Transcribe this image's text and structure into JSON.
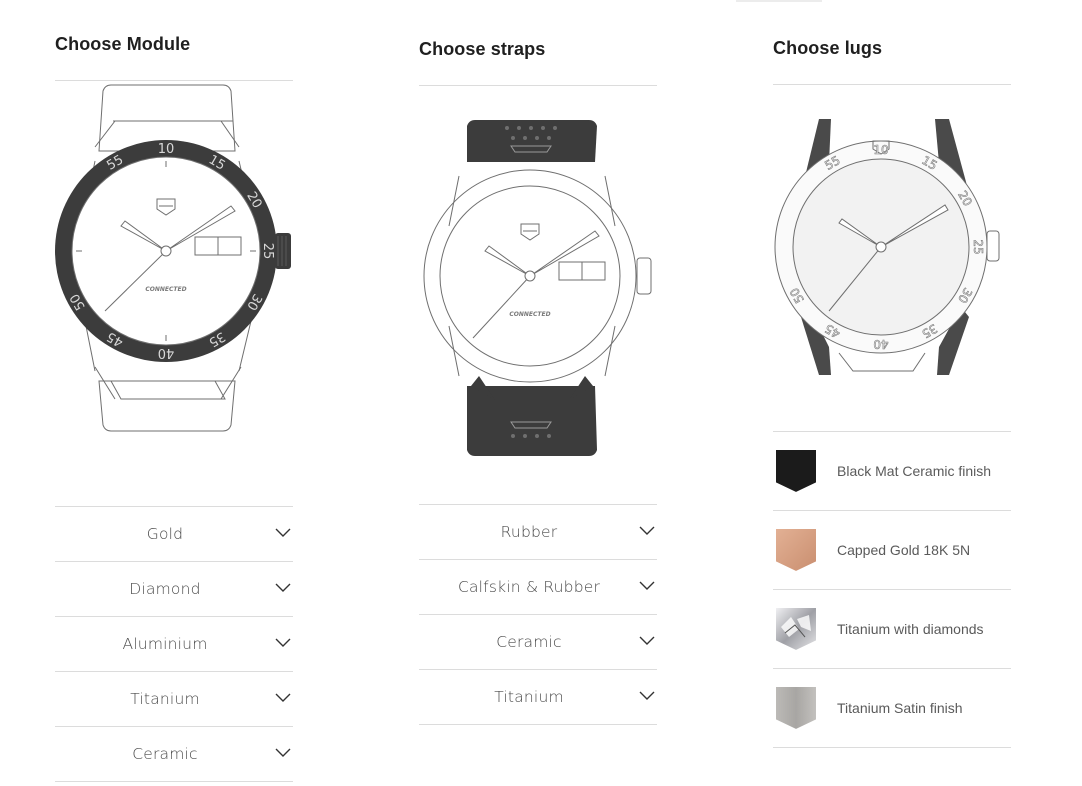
{
  "module": {
    "title": "Choose Module",
    "dial_brand": "CONNECTED",
    "bezel_numbers": [
      "55",
      "10",
      "15",
      "20",
      "25",
      "30",
      "35",
      "40",
      "45",
      "50"
    ],
    "options": [
      "Gold",
      "Diamond",
      "Aluminium",
      "Titanium",
      "Ceramic"
    ]
  },
  "straps": {
    "title": "Choose straps",
    "dial_brand": "CONNECTED",
    "options": [
      "Rubber",
      "Calfskin & Rubber",
      "Ceramic",
      "Titanium"
    ]
  },
  "lugs": {
    "title": "Choose lugs",
    "bezel_numbers": [
      "55",
      "10",
      "15",
      "20",
      "25",
      "30",
      "35",
      "40",
      "45",
      "50"
    ],
    "finishes": [
      {
        "label": "Black Mat Ceramic finish",
        "color": "#1b1b1b"
      },
      {
        "label": "Capped Gold 18K 5N",
        "color": "#d9a184"
      },
      {
        "label": "Titanium with diamonds",
        "color": "#c9c9cb"
      },
      {
        "label": "Titanium Satin finish",
        "color": "#b3b1ae"
      }
    ]
  },
  "colors": {
    "outline": "#6f6f6f",
    "dark": "#3c3c3c",
    "divider": "#dcdcdc",
    "heading": "#1f1f1f"
  }
}
